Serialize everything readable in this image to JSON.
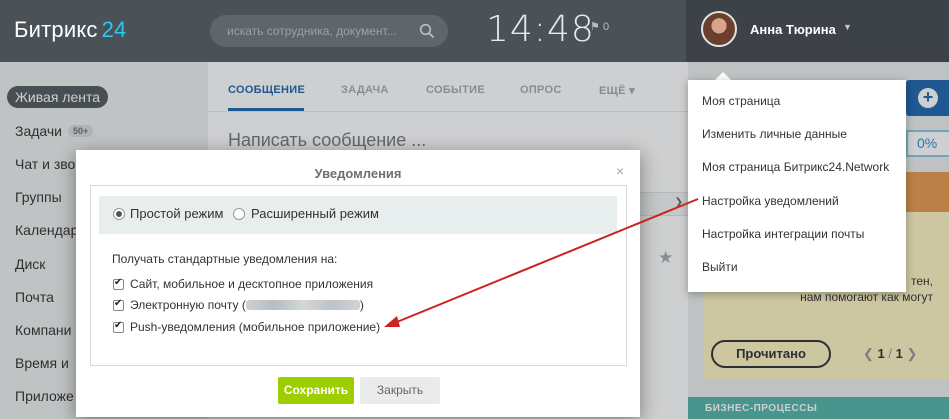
{
  "colors": {
    "header_bg": "#4a5157",
    "brand_accent": "#2fc6f6",
    "tab_active": "#2067b0",
    "save_button": "#9dcf00",
    "card_yellow": "#fdf4c3",
    "card_orange": "#e79a50",
    "bp_teal": "#52b5aa",
    "arrow": "#cc2222"
  },
  "header": {
    "logo_text": "Битрикс",
    "logo_accent": "24",
    "search_placeholder": "искать сотрудника, документ...",
    "search_icon": "search-icon",
    "clock": "14:48",
    "flag_count": "0",
    "user_name": "Анна Тюрина"
  },
  "sidebar": {
    "items": [
      {
        "label": "Живая лента"
      },
      {
        "label": "Задачи",
        "badge": "50+"
      },
      {
        "label": "Чат и зво"
      },
      {
        "label": "Группы"
      },
      {
        "label": "Календар"
      },
      {
        "label": "Диск"
      },
      {
        "label": "Почта"
      },
      {
        "label": "Компани"
      },
      {
        "label": "Время и"
      },
      {
        "label": "Приложе"
      }
    ]
  },
  "feed": {
    "tabs": [
      {
        "label": "СООБЩЕНИЕ"
      },
      {
        "label": "ЗАДАЧА"
      },
      {
        "label": "СОБЫТИЕ"
      },
      {
        "label": "ОПРОС"
      },
      {
        "label": "ЕЩЁ"
      }
    ],
    "compose_placeholder": "Написать сообщение ..."
  },
  "user_menu": {
    "items": [
      {
        "label": "Моя страница"
      },
      {
        "label": "Изменить личные данные"
      },
      {
        "label": "Моя страница Битрикс24.Network"
      },
      {
        "label": "Настройка уведомлений"
      },
      {
        "label": "Настройка интеграции почты"
      },
      {
        "label": "Выйти"
      }
    ]
  },
  "right": {
    "percent": "0%",
    "card_line1": "тен,",
    "card_line2": "нам помогают как могут",
    "read_button": "Прочитано",
    "pager_current": "1",
    "pager_sep": "/",
    "pager_total": "1",
    "bp_title": "БИЗНЕС-ПРОЦЕССЫ"
  },
  "dialog": {
    "title": "Уведомления",
    "mode_simple": "Простой режим",
    "mode_advanced": "Расширенный режим",
    "mode_selected": "Простой режим",
    "section_label": "Получать стандартные уведомления на:",
    "options": [
      {
        "label": "Сайт, мобильное и десктопное приложения",
        "checked": true
      },
      {
        "label_prefix": "Электронную почту (",
        "label_suffix": ")",
        "checked": true
      },
      {
        "label": "Push-уведомления (мобильное приложение)",
        "checked": true
      }
    ],
    "save_label": "Сохранить",
    "close_label": "Закрыть"
  }
}
